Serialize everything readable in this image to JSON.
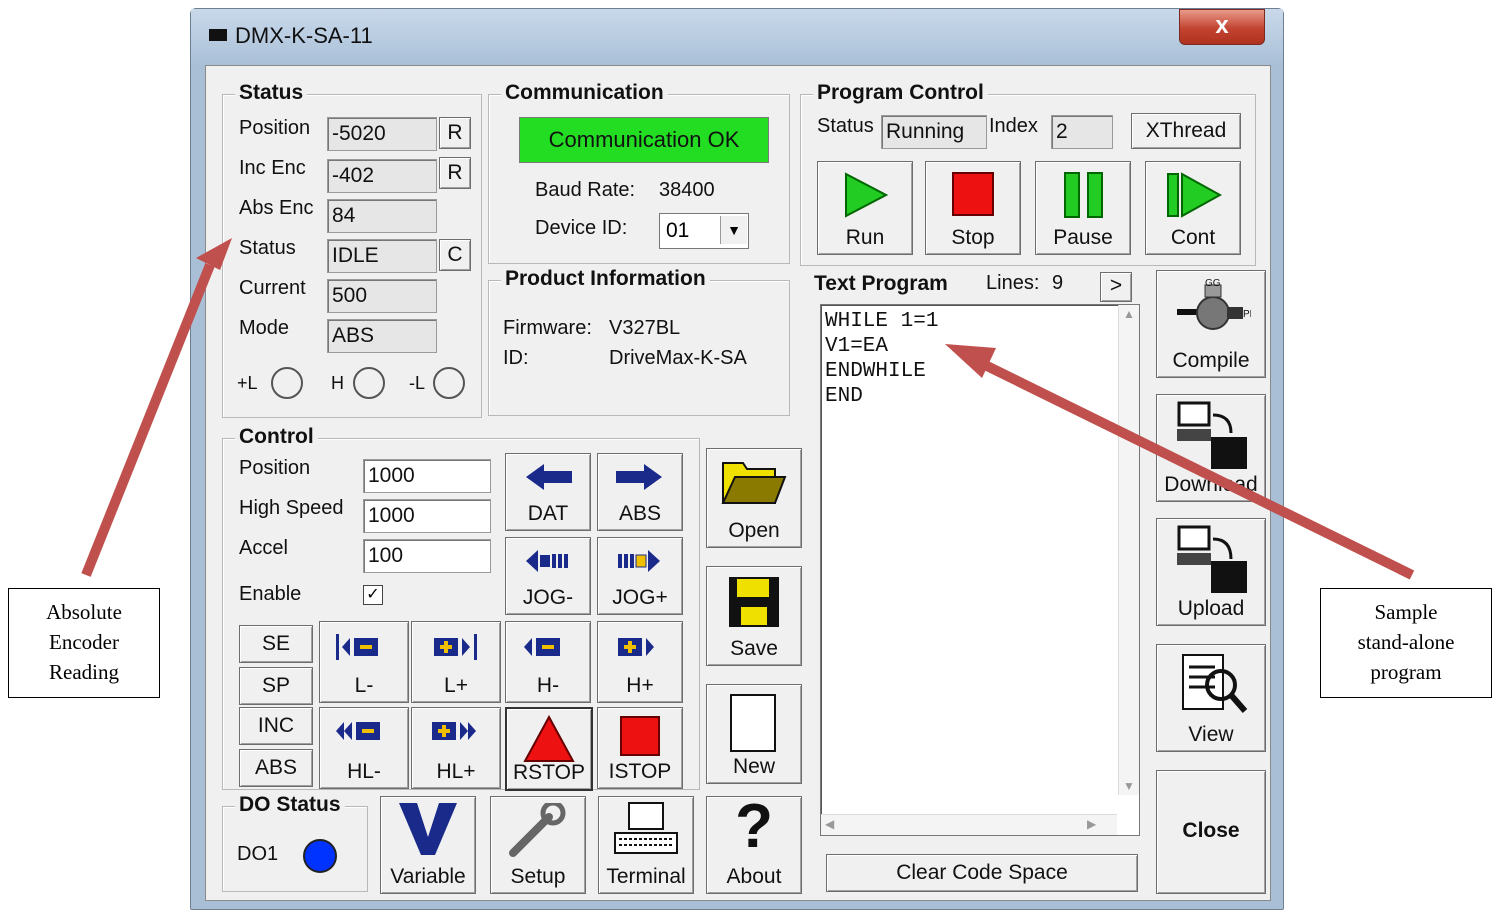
{
  "window": {
    "title": "DMX-K-SA-11",
    "close_label": "x"
  },
  "status": {
    "group_label": "Status",
    "position_label": "Position",
    "position_value": "-5020",
    "position_reset": "R",
    "inc_enc_label": "Inc Enc",
    "inc_enc_value": "-402",
    "inc_enc_reset": "R",
    "abs_enc_label": "Abs Enc",
    "abs_enc_value": "84",
    "status_label": "Status",
    "status_value": "IDLE",
    "status_clear": "C",
    "current_label": "Current",
    "current_value": "500",
    "mode_label": "Mode",
    "mode_value": "ABS",
    "limit_plus": "+L",
    "home": "H",
    "limit_minus": "-L"
  },
  "communication": {
    "group_label": "Communication",
    "status_text": "Communication OK",
    "baud_label": "Baud Rate:",
    "baud_value": "38400",
    "device_id_label": "Device ID:",
    "device_id_value": "01"
  },
  "product": {
    "group_label": "Product Information",
    "firmware_label": "Firmware:",
    "firmware_value": "V327BL",
    "id_label": "ID:",
    "id_value": "DriveMax-K-SA"
  },
  "program_control": {
    "group_label": "Program Control",
    "status_label": "Status",
    "status_value": "Running",
    "index_label": "Index",
    "index_value": "2",
    "xthread_label": "XThread",
    "run_label": "Run",
    "stop_label": "Stop",
    "pause_label": "Pause",
    "cont_label": "Cont"
  },
  "text_program": {
    "label": "Text Program",
    "lines_label": "Lines:",
    "lines_value": "9",
    "next_label": ">",
    "code": "WHILE 1=1\nV1=EA\nENDWHILE\nEND",
    "clear_label": "Clear Code Space"
  },
  "side": {
    "compile_label": "Compile",
    "download_label": "Download",
    "upload_label": "Upload",
    "view_label": "View",
    "close_label": "Close"
  },
  "control": {
    "group_label": "Control",
    "position_label": "Position",
    "position_value": "1000",
    "high_speed_label": "High Speed",
    "high_speed_value": "1000",
    "accel_label": "Accel",
    "accel_value": "100",
    "enable_label": "Enable",
    "enable_checked": true,
    "dat_label": "DAT",
    "abs_move_label": "ABS",
    "jog_minus": "JOG-",
    "jog_plus": "JOG+",
    "se_label": "SE",
    "sp_label": "SP",
    "inc_label": "INC",
    "abs_label": "ABS",
    "l_minus": "L-",
    "l_plus": "L+",
    "h_minus": "H-",
    "h_plus": "H+",
    "hl_minus": "HL-",
    "hl_plus": "HL+",
    "rstop_label": "RSTOP",
    "istop_label": "ISTOP"
  },
  "file": {
    "open_label": "Open",
    "save_label": "Save",
    "new_label": "New"
  },
  "do_status": {
    "group_label": "DO Status",
    "do1_label": "DO1"
  },
  "bottom": {
    "variable_label": "Variable",
    "setup_label": "Setup",
    "terminal_label": "Terminal",
    "about_label": "About"
  },
  "annotations": {
    "left_note": "Absolute\nEncoder\nReading",
    "right_note": "Sample\nstand-alone\nprogram"
  },
  "colors": {
    "comm_ok_bg": "#22dd22",
    "arrow": "#c0504d",
    "led_blue": "#0033ff",
    "play_green": "#22cc22",
    "stop_red": "#ee1111"
  }
}
